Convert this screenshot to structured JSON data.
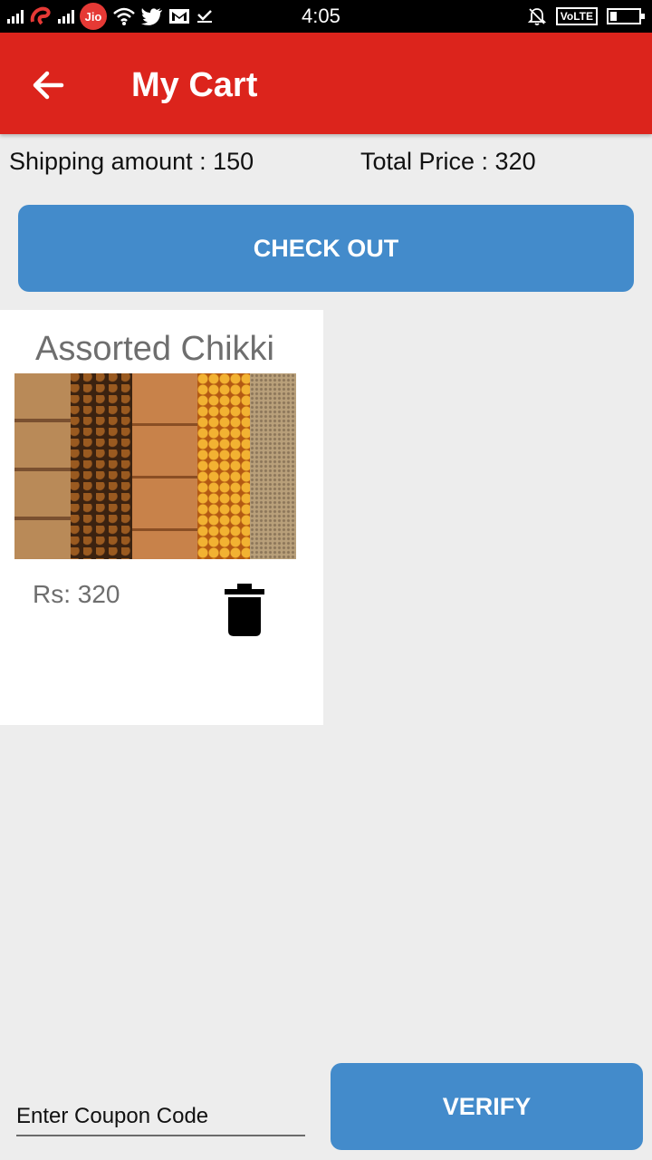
{
  "status_bar": {
    "time": "4:05",
    "carrier_badge": "Jio",
    "network_label": "VoLTE"
  },
  "app_bar": {
    "title": "My Cart",
    "back_icon": "arrow-left-icon"
  },
  "summary": {
    "shipping_text": "Shipping amount : 150",
    "total_text": "Total Price : 320"
  },
  "checkout_button": {
    "label": "CHECK OUT"
  },
  "cart_items": [
    {
      "name": "Assorted Chikki",
      "price_text": "Rs: 320",
      "delete_icon": "trash-icon"
    }
  ],
  "coupon": {
    "placeholder": "Enter Coupon Code",
    "value": ""
  },
  "verify_button": {
    "label": "VERIFY"
  },
  "colors": {
    "app_bar": "#dc241c",
    "button": "#438bcb",
    "background": "#ededed",
    "card": "#ffffff"
  }
}
